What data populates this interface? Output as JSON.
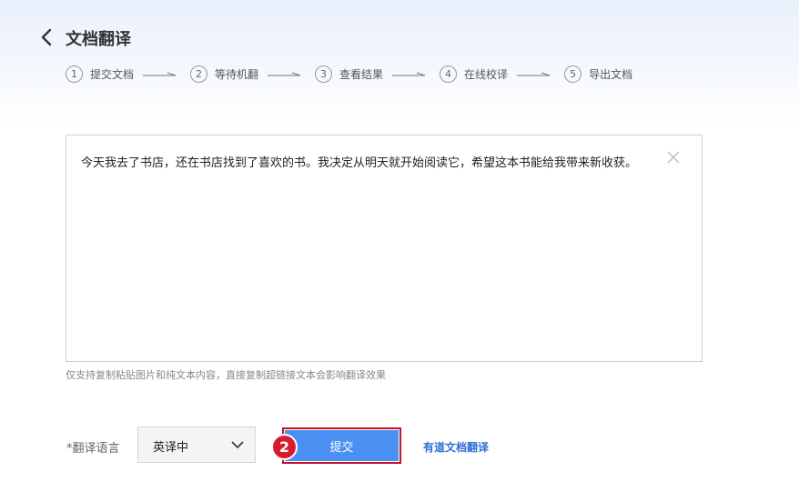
{
  "header": {
    "title": "文档翻译",
    "steps": [
      {
        "num": "1",
        "label": "提交文档"
      },
      {
        "num": "2",
        "label": "等待机翻"
      },
      {
        "num": "3",
        "label": "查看结果"
      },
      {
        "num": "4",
        "label": "在线校译"
      },
      {
        "num": "5",
        "label": "导出文档"
      }
    ]
  },
  "editor": {
    "text": "今天我去了书店，还在书店找到了喜欢的书。我决定从明天就开始阅读它，希望这本书能给我带来新收获。",
    "hint": "仅支持复制粘贴图片和纯文本内容，直接复制超链接文本会影响翻译效果"
  },
  "footer": {
    "lang_label": "*翻译语言",
    "lang_value": "英译中",
    "submit_label": "提交",
    "badge": "2",
    "link_label": "有道文档翻译"
  },
  "colors": {
    "accent": "#4a90f2",
    "highlight": "#c1122c",
    "badge": "#d81b30",
    "link": "#2f6fd6"
  },
  "icons": {
    "back": "chevron-left-icon",
    "clear": "close-icon",
    "select": "chevron-down-icon",
    "arrow": "step-arrow-icon"
  }
}
